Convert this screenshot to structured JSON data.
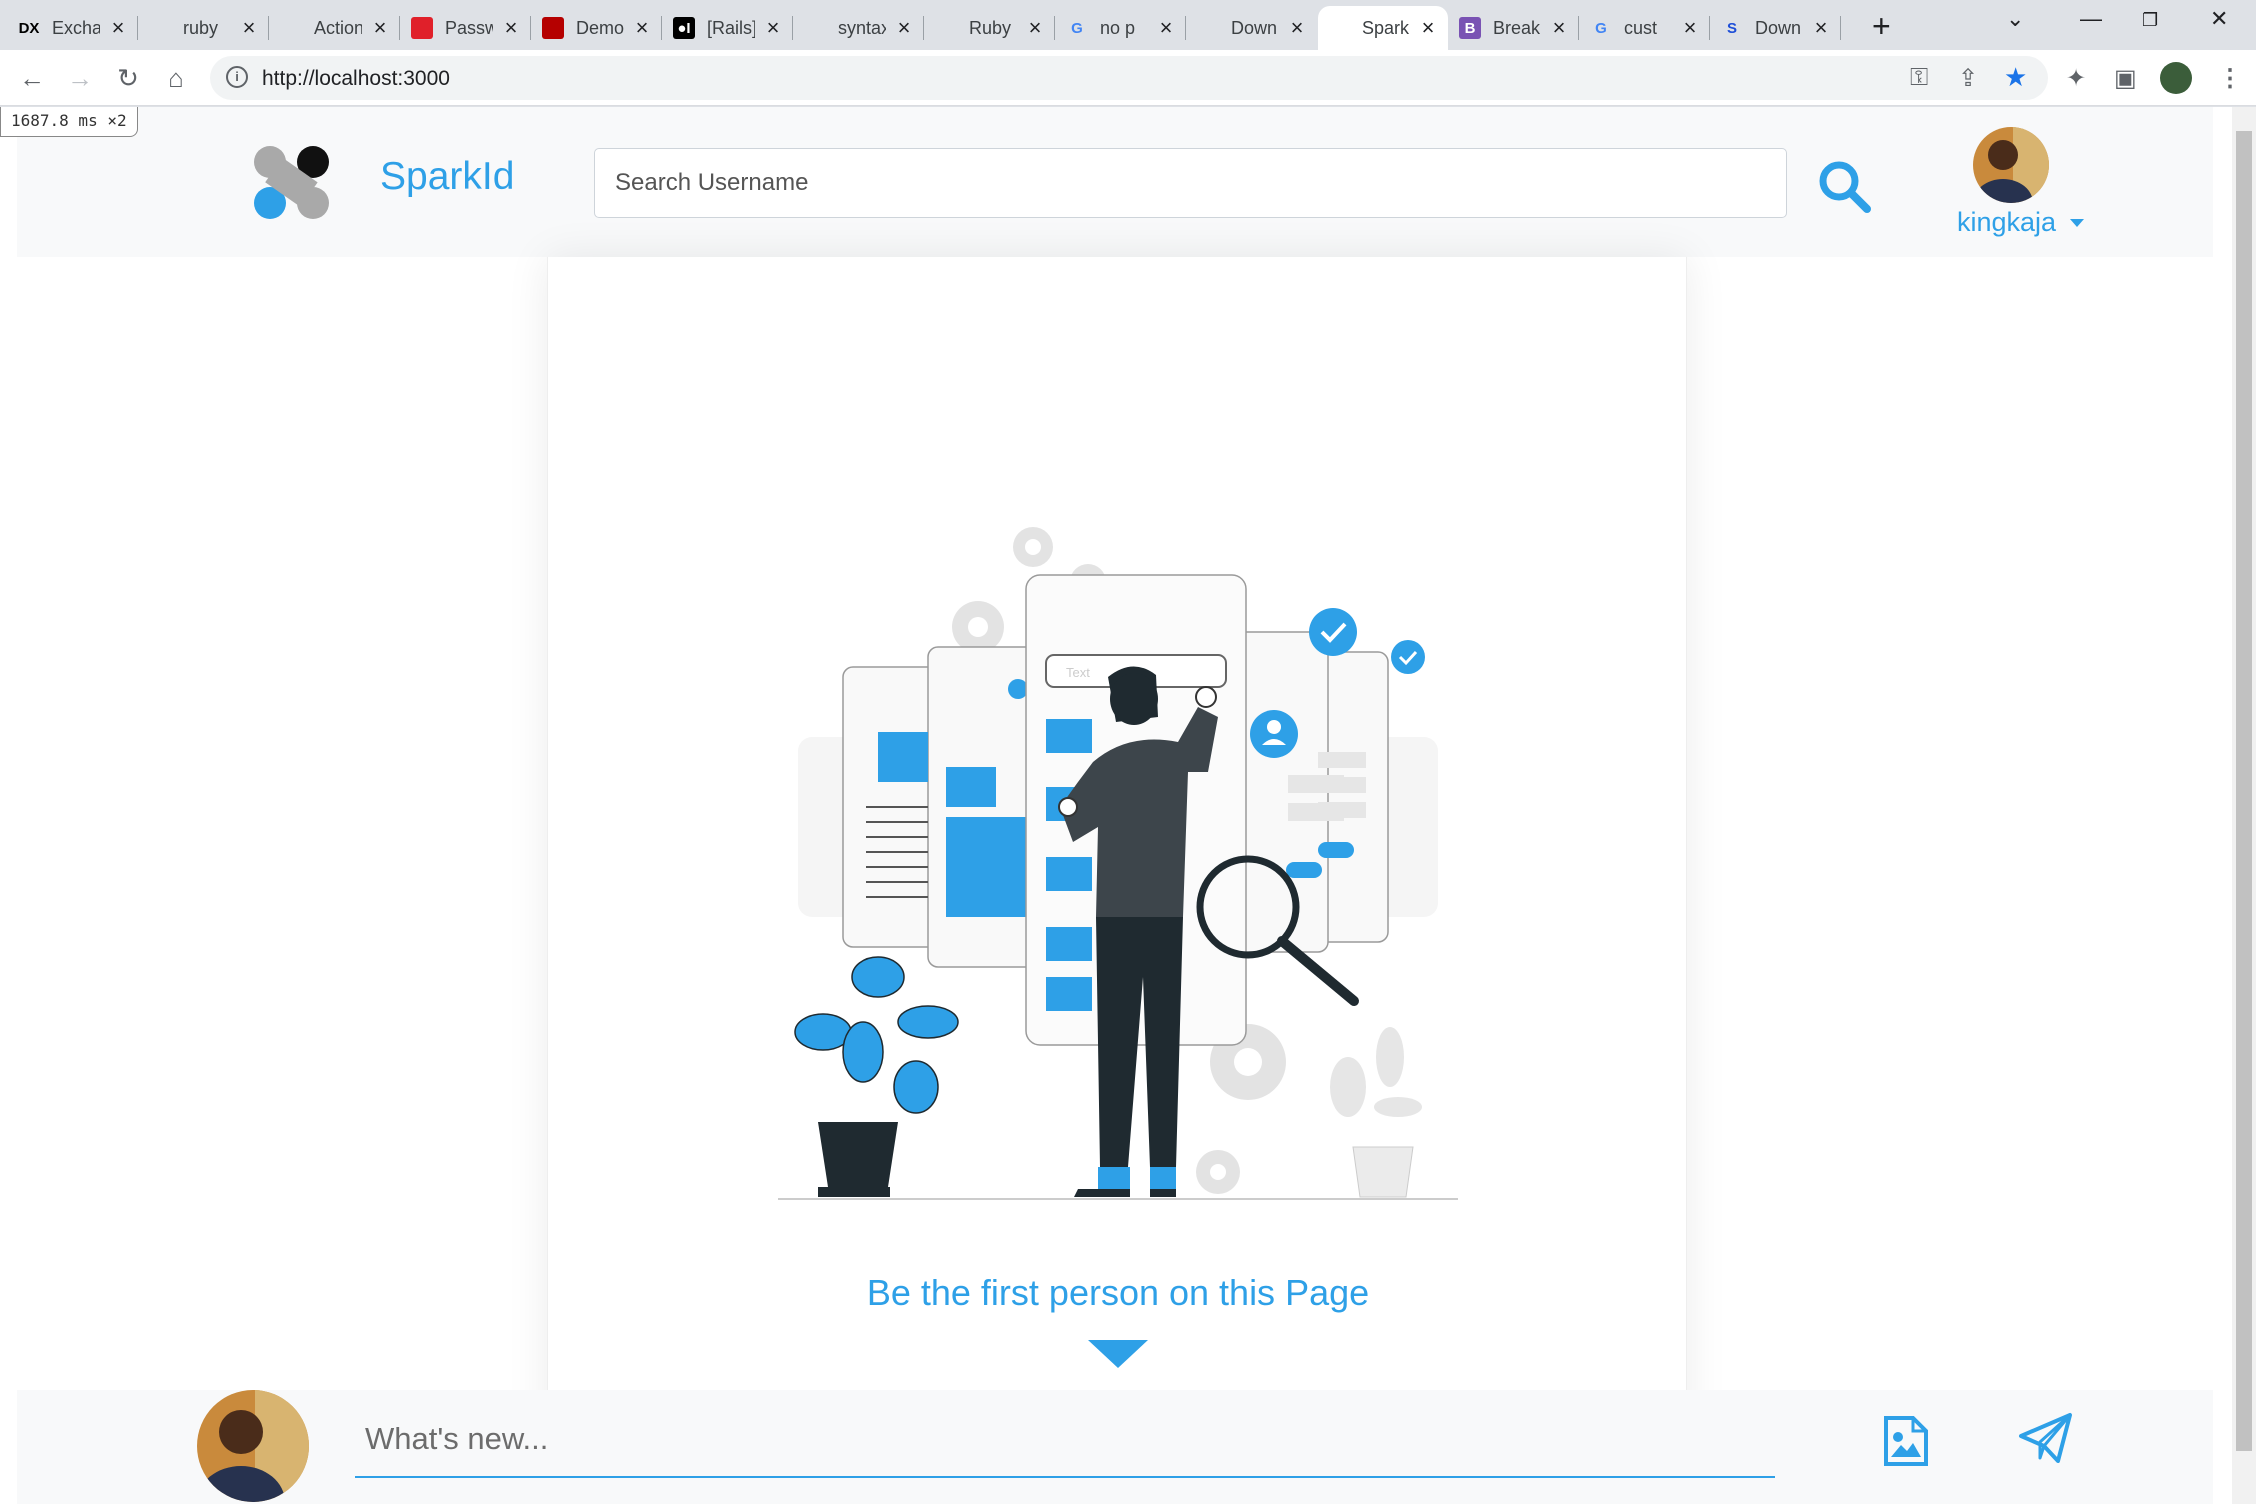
{
  "browser": {
    "tabs": [
      {
        "title": "Exchange",
        "icon": "dx-icon",
        "icon_text": "DX",
        "icon_color": "#000000",
        "icon_bg": "transparent"
      },
      {
        "title": "ruby",
        "icon": "stackoverflow-icon",
        "icon_text": "",
        "icon_color": "#f48024",
        "icon_bg": "transparent"
      },
      {
        "title": "Action",
        "icon": "rails-icon",
        "icon_text": "",
        "icon_color": "#cc0000",
        "icon_bg": "transparent"
      },
      {
        "title": "Passwords",
        "icon": "oracle-icon",
        "icon_text": "",
        "icon_color": "#e0202a",
        "icon_bg": "#e0202a"
      },
      {
        "title": "Demo",
        "icon": "ruby-icon",
        "icon_text": "",
        "icon_color": "#b50000",
        "icon_bg": "#b50000"
      },
      {
        "title": "[Rails]",
        "icon": "medium-icon",
        "icon_text": "●I",
        "icon_color": "#ffffff",
        "icon_bg": "#000000"
      },
      {
        "title": "syntax",
        "icon": "stackoverflow-icon",
        "icon_text": "",
        "icon_color": "#f48024",
        "icon_bg": "transparent"
      },
      {
        "title": "Ruby",
        "icon": "ruby-doc-icon",
        "icon_text": "",
        "icon_color": "#555555",
        "icon_bg": "transparent"
      },
      {
        "title": "no p",
        "icon": "google-icon",
        "icon_text": "G",
        "icon_color": "#4285f4",
        "icon_bg": "transparent"
      },
      {
        "title": "Down",
        "icon": "robot-icon",
        "icon_text": "",
        "icon_color": "#2a6fd6",
        "icon_bg": "transparent"
      },
      {
        "title": "SparkId",
        "icon": "sparkid-icon",
        "icon_text": "",
        "icon_color": "#2ea0e7",
        "icon_bg": "transparent"
      },
      {
        "title": "Break",
        "icon": "bootstrap-icon",
        "icon_text": "B",
        "icon_color": "#ffffff",
        "icon_bg": "#7952b3"
      },
      {
        "title": "cust",
        "icon": "google-icon",
        "icon_text": "G",
        "icon_color": "#4285f4",
        "icon_bg": "transparent"
      },
      {
        "title": "Down",
        "icon": "shopify-icon",
        "icon_text": "S",
        "icon_color": "#1d4ed8",
        "icon_bg": "transparent"
      }
    ],
    "active_tab": 10,
    "url": "http://localhost:3000",
    "perf_badge": "1687.8 ms ×2"
  },
  "header": {
    "brand": "SparkId",
    "search_placeholder": "Search Username",
    "username": "kingkaja"
  },
  "main": {
    "empty_message": "Be the first person on this Page",
    "illustration_caption": "Text"
  },
  "composer": {
    "placeholder": "What's new..."
  },
  "colors": {
    "accent": "#2ea0e7",
    "header_bg": "#f8f9fa"
  }
}
